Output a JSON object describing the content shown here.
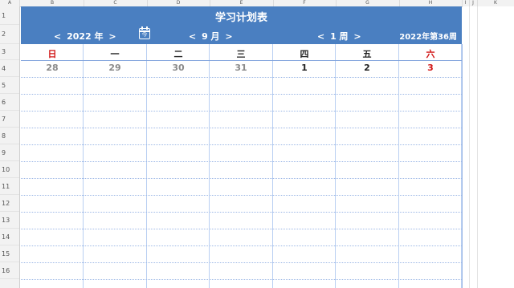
{
  "spreadsheet": {
    "columns": [
      "A",
      "B",
      "C",
      "D",
      "E",
      "F",
      "G",
      "H",
      "I",
      "J",
      "K"
    ],
    "rows": [
      "1",
      "2",
      "3",
      "4",
      "5",
      "6",
      "7",
      "8",
      "9",
      "10",
      "11",
      "12",
      "13",
      "14",
      "15",
      "16"
    ]
  },
  "planner": {
    "title": "学习计划表",
    "year_label": "2022 年",
    "month_label": "9 月",
    "week_label": "1 周",
    "calendar_icon_text": "今",
    "week_summary": "2022年第36周",
    "prev_arrow": "<",
    "next_arrow": ">",
    "weekdays": [
      "日",
      "一",
      "二",
      "三",
      "四",
      "五",
      "六"
    ],
    "dates": [
      "28",
      "29",
      "30",
      "31",
      "1",
      "2",
      "3"
    ],
    "colors": {
      "header_bg": "#4a7fc1",
      "weekend": "#d11515",
      "other_month": "#8a8a8a",
      "grid_line": "#9db8e6"
    }
  }
}
